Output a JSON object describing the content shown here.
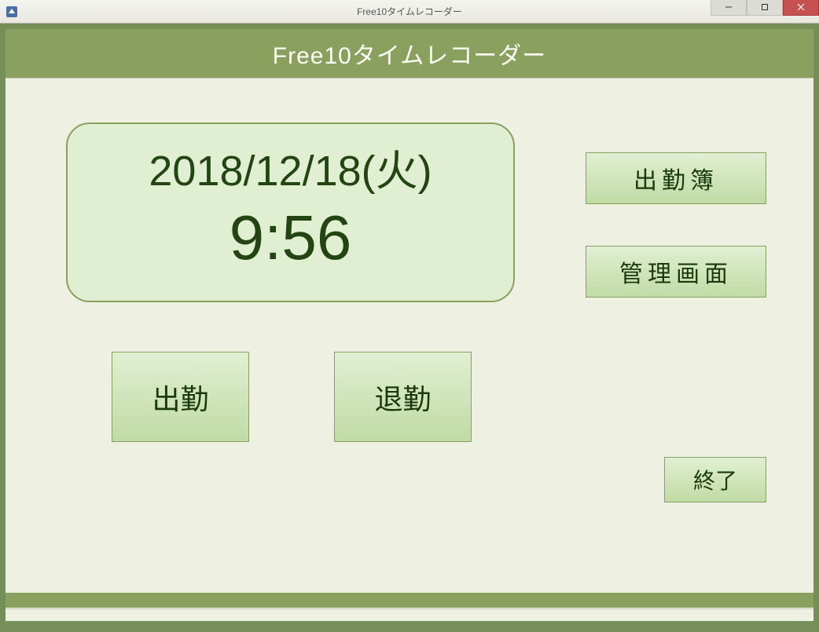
{
  "window": {
    "title": "Free10タイムレコーダー"
  },
  "header": {
    "title": "Free10タイムレコーダー"
  },
  "clock": {
    "date": "2018/12/18(火)",
    "time": "9:56"
  },
  "buttons": {
    "clock_in": "出勤",
    "clock_out": "退勤",
    "attendance_book": "出勤簿",
    "admin_screen": "管理画面",
    "exit": "終了"
  },
  "icons": {
    "app": "app-icon",
    "minimize": "minimize-icon",
    "maximize": "maximize-icon",
    "close": "close-icon"
  }
}
